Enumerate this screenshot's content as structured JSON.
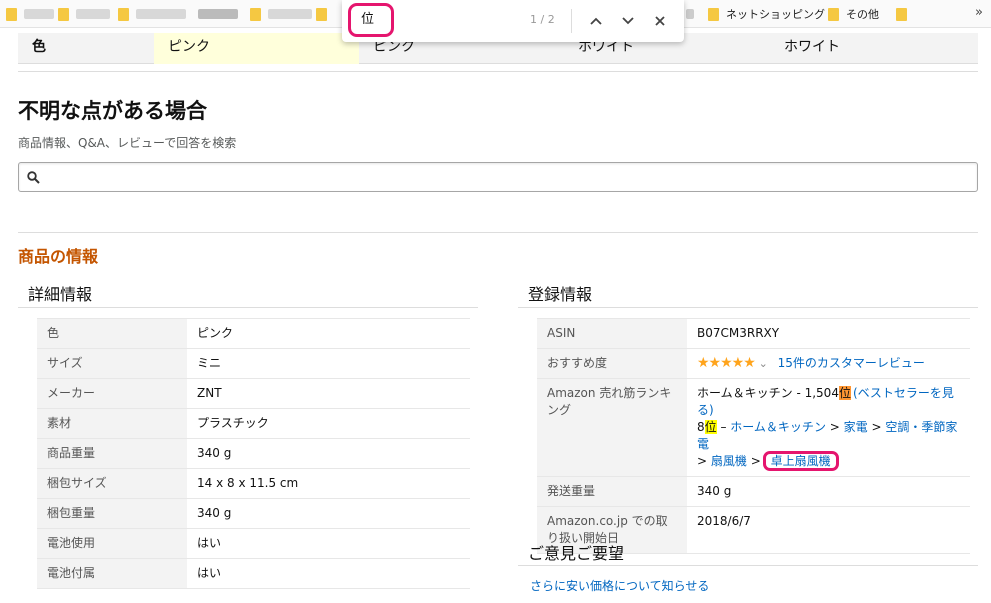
{
  "bookmarks": {
    "items": [
      {
        "label": ""
      },
      {
        "label": ""
      },
      {
        "label": ""
      },
      {
        "label": ""
      },
      {
        "label": ""
      },
      {
        "label": "ネットショッピング"
      },
      {
        "label": "その他"
      }
    ],
    "more": "»"
  },
  "find": {
    "query": "位",
    "count": "1 / 2",
    "prev_icon": "chevron-up-icon",
    "next_icon": "chevron-down-icon",
    "close_icon": "close-icon"
  },
  "color_row": {
    "label": "色",
    "values": [
      "ピンク",
      "ピンク",
      "ホワイト",
      "ホワイト"
    ]
  },
  "question": {
    "title": "不明な点がある場合",
    "subtitle": "商品情報、Q&A、レビューで回答を検索",
    "search_placeholder": ""
  },
  "product_info": {
    "title": "商品の情報",
    "details": {
      "title": "詳細情報",
      "rows": [
        {
          "label": "色",
          "value": "ピンク"
        },
        {
          "label": "サイズ",
          "value": "ミニ"
        },
        {
          "label": "メーカー",
          "value": "ZNT"
        },
        {
          "label": "素材",
          "value": "プラスチック"
        },
        {
          "label": "商品重量",
          "value": "340 g"
        },
        {
          "label": "梱包サイズ",
          "value": "14 x 8 x 11.5 cm"
        },
        {
          "label": "梱包重量",
          "value": "340 g"
        },
        {
          "label": "電池使用",
          "value": "はい"
        },
        {
          "label": "電池付属",
          "value": "はい"
        }
      ]
    },
    "registration": {
      "title": "登録情報",
      "asin_label": "ASIN",
      "asin_value": "B07CM3RRXY",
      "rec_label": "おすすめ度",
      "rating_stars": "★★★★★",
      "rating_chevron": "⌄",
      "reviews_link": "15件のカスタマーレビュー",
      "rank_label": "Amazon 売れ筋ランキング",
      "rank_line1_prefix": "ホーム＆キッチン - 1,504",
      "rank_i1": "位",
      "rank_line1_link": "(ベストセラーを見る)",
      "rank_line2_prefix": "8",
      "rank_i2": "位",
      "rank_dash": " – ",
      "cat_home": "ホーム＆キッチン",
      "sep": " > ",
      "cat_appliance": "家電",
      "cat_aircon": "空調・季節家電",
      "cat_fan": "扇風機",
      "cat_desk_fan": "卓上扇風機",
      "ship_label": "発送重量",
      "ship_value": "340 g",
      "start_label": "Amazon.co.jp での取り扱い開始日",
      "start_value": "2018/6/7"
    }
  },
  "feedback": {
    "title": "ご意見ご要望",
    "link": "さらに安い価格について知らせる"
  }
}
